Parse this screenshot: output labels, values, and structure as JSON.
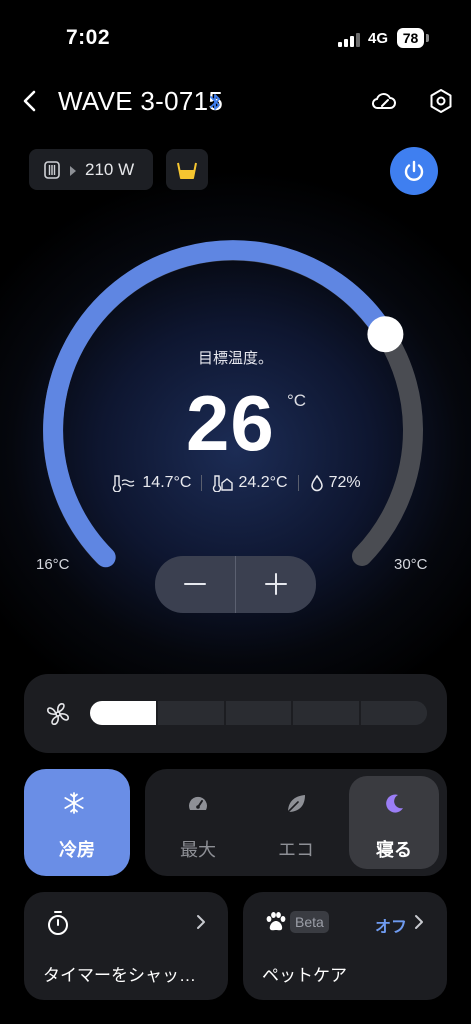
{
  "status_bar": {
    "time": "7:02",
    "network": "4G",
    "battery": "78"
  },
  "header": {
    "title": "WAVE 3-0715"
  },
  "power_chip": {
    "value": "210 W"
  },
  "dial": {
    "target_label": "目標温度。",
    "target_temp": "26",
    "unit": "°C",
    "min_label": "16°C",
    "max_label": "30°C",
    "min": 16,
    "max": 30,
    "value": 26
  },
  "readings": {
    "outdoor": "14.7°C",
    "indoor": "24.2°C",
    "humidity": "72%"
  },
  "fan": {
    "level": 1,
    "levels": 5
  },
  "modes": {
    "cool": "冷房",
    "items": [
      {
        "label": "最大",
        "icon": "gauge-icon",
        "active": false
      },
      {
        "label": "エコ",
        "icon": "leaf-icon",
        "active": false
      },
      {
        "label": "寝る",
        "icon": "moon-icon",
        "active": true
      }
    ]
  },
  "timer": {
    "label": "タイマーをシャッ…"
  },
  "pet_care": {
    "badge": "Beta",
    "state": "オフ",
    "label": "ペットケア"
  },
  "colors": {
    "accent": "#6a8ee6",
    "power": "#3f7ff0",
    "off": "#6f9bf0",
    "moon": "#9b7ef6",
    "tank": "#f6c630"
  }
}
